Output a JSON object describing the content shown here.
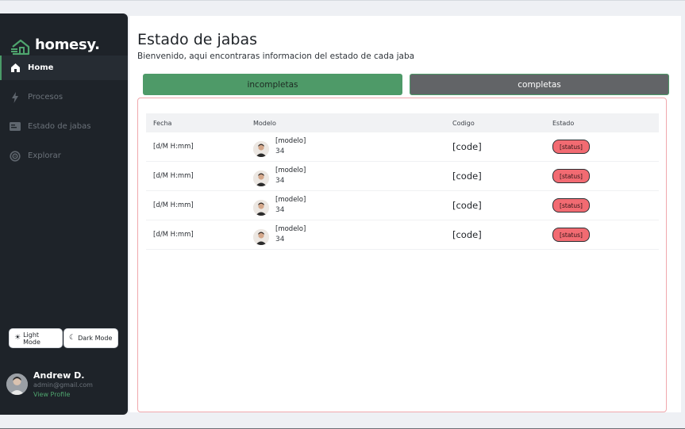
{
  "brand": {
    "name": "homesy.",
    "accent": "#4a9b68"
  },
  "sidebar": {
    "items": [
      {
        "label": "Home",
        "icon": "home-icon",
        "active": true
      },
      {
        "label": "Procesos",
        "icon": "bolt-icon",
        "active": false
      },
      {
        "label": "Estado de jabas",
        "icon": "card-icon",
        "active": false
      },
      {
        "label": "Explorar",
        "icon": "compass-icon",
        "active": false
      }
    ],
    "mode": {
      "light_label": "Light Mode",
      "dark_label": "Dark Mode"
    },
    "profile": {
      "name": "Andrew D.",
      "email": "admin@gmail.com",
      "link": "View Profile"
    }
  },
  "main": {
    "title": "Estado de jabas",
    "subtitle": "Bienvenido, aqui encontraras informacion del estado de cada jaba",
    "tabs": {
      "incompletas": "incompletas",
      "completas": "completas"
    },
    "table": {
      "headers": {
        "fecha": "Fecha",
        "modelo": "Modelo",
        "codigo": "Codigo",
        "estado": "Estado"
      },
      "rows": [
        {
          "fecha": "[d/M H:mm]",
          "modelo": "[modelo]",
          "numero": "34",
          "codigo": "[code]",
          "estado": "[status]"
        },
        {
          "fecha": "[d/M H:mm]",
          "modelo": "[modelo]",
          "numero": "34",
          "codigo": "[code]",
          "estado": "[status]"
        },
        {
          "fecha": "[d/M H:mm]",
          "modelo": "[modelo]",
          "numero": "34",
          "codigo": "[code]",
          "estado": "[status]"
        },
        {
          "fecha": "[d/M H:mm]",
          "modelo": "[modelo]",
          "numero": "34",
          "codigo": "[code]",
          "estado": "[status]"
        }
      ]
    }
  },
  "colors": {
    "status_badge": "#f26b72",
    "tab_incompletas": "#4e9a68",
    "tab_completas": "#626467",
    "sidebar_bg": "#1e2329"
  }
}
